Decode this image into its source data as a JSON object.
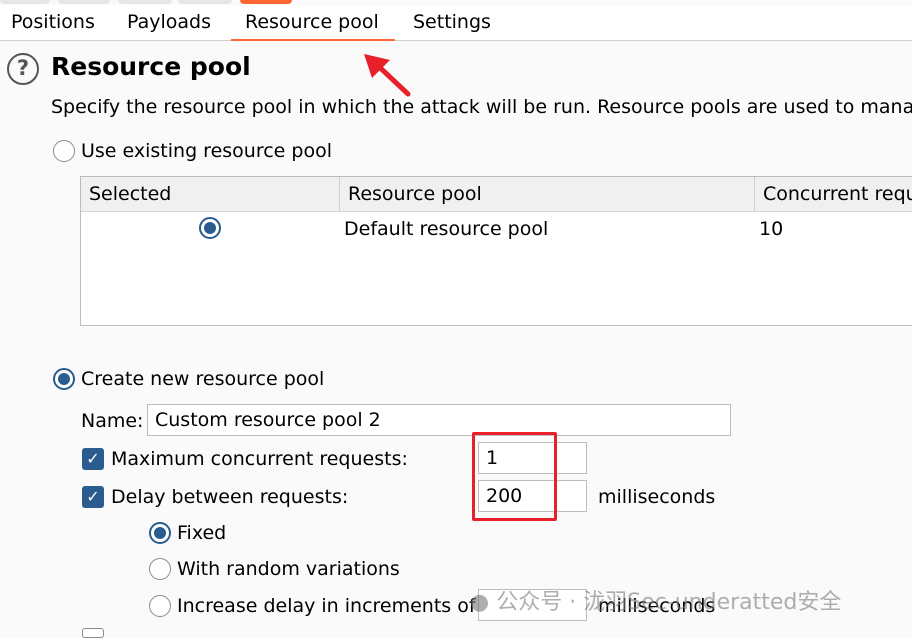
{
  "tabs": [
    {
      "label": "Positions"
    },
    {
      "label": "Payloads"
    },
    {
      "label": "Resource pool",
      "active": true
    },
    {
      "label": "Settings"
    }
  ],
  "section": {
    "title": "Resource pool",
    "description": "Specify the resource pool in which the attack will be run. Resource pools are used to mana"
  },
  "existing": {
    "label": "Use existing resource pool",
    "selected": false,
    "columns": [
      "Selected",
      "Resource pool",
      "Concurrent requ"
    ],
    "rows": [
      {
        "selected": true,
        "pool": "Default resource pool",
        "concurrent": "10"
      }
    ]
  },
  "create": {
    "label": "Create new resource pool",
    "selected": true,
    "name_label": "Name:",
    "name_value": "Custom resource pool 2",
    "max_label": "Maximum concurrent requests:",
    "max_checked": true,
    "max_value": "1",
    "delay_label": "Delay between requests:",
    "delay_checked": true,
    "delay_value": "200",
    "delay_unit": "milliseconds",
    "options": [
      {
        "label": "Fixed",
        "selected": true
      },
      {
        "label": "With random variations",
        "selected": false
      },
      {
        "label": "Increase delay in increments of",
        "selected": false
      }
    ],
    "increment_value": "",
    "increment_unit": "milliseconds"
  },
  "watermark": "公众号 · 泷羽Sec-underatted安全",
  "colors": {
    "accent": "#ff6633",
    "control": "#2a5c8f",
    "annotation": "#e8202a"
  }
}
